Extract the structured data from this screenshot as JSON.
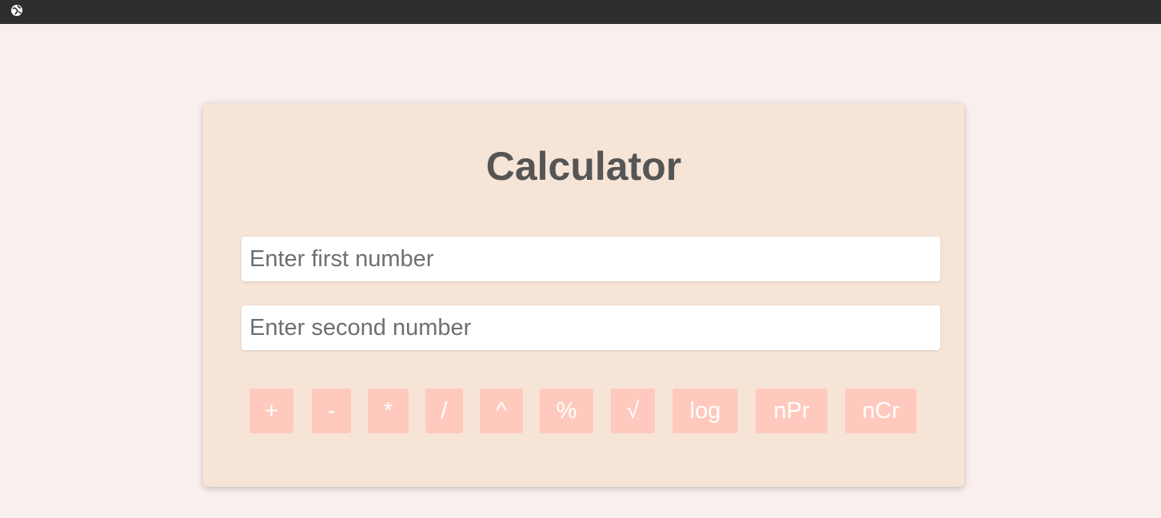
{
  "title": "Calculator",
  "inputs": {
    "first_placeholder": "Enter first number",
    "second_placeholder": "Enter second number"
  },
  "buttons": {
    "add": "+",
    "subtract": "-",
    "multiply": "*",
    "divide": "/",
    "power": "^",
    "modulo": "%",
    "sqrt": "√",
    "log": "log",
    "npr": "nPr",
    "ncr": "nCr"
  },
  "colors": {
    "topbar": "#2e2e2e",
    "page_background": "#f8efee",
    "card_background": "#f6e4d7",
    "button_background": "#ffc9bd",
    "title_color": "#555555"
  },
  "icons": {
    "topbar_icon": "globe-icon"
  }
}
